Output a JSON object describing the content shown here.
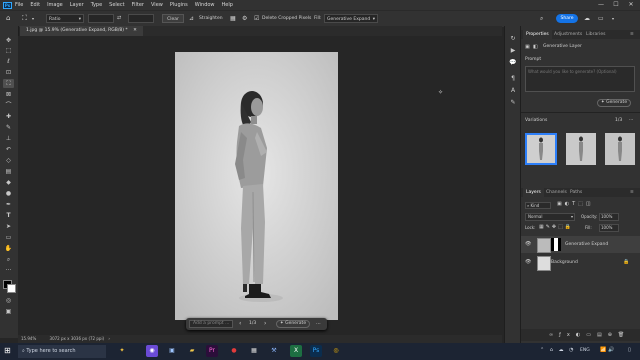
{
  "menu": {
    "logo": "Ps",
    "items": [
      "File",
      "Edit",
      "Image",
      "Layer",
      "Type",
      "Select",
      "Filter",
      "View",
      "Plugins",
      "Window",
      "Help"
    ]
  },
  "window_controls": {
    "minimize": "—",
    "maximize": "☐",
    "close": "✕"
  },
  "options": {
    "ratio_value": "Ratio",
    "clear_label": "Clear",
    "straighten_label": "Straighten",
    "delete_cropped_label": "Delete Cropped Pixels",
    "fill_label": "Fill:",
    "fill_value": "Generative Expand",
    "share_label": "Share"
  },
  "document": {
    "tab_title": "1.jpg @ 15.9% (Generative Expand, RGB/8) *",
    "close_glyph": "✕"
  },
  "contextual_bar": {
    "prompt_placeholder": "Add a prompt ...",
    "variation_counter": "1/3",
    "generate_label": "Generate",
    "more": "···"
  },
  "status": {
    "zoom": "15.94%",
    "doc_info": "3072 px x 3036 px (72 ppi)"
  },
  "properties": {
    "tabs": [
      "Properties",
      "Adjustments",
      "Libraries"
    ],
    "layer_type": "Generative Layer",
    "prompt_label": "Prompt",
    "prompt_placeholder": "What would you like to generate? (Optional)",
    "generate_label": "Generate",
    "variations_label": "Variations",
    "variations_count": "1/3"
  },
  "layers": {
    "tabs": [
      "Layers",
      "Channels",
      "Paths"
    ],
    "filter_value": "Kind",
    "blend_mode": "Normal",
    "opacity_label": "Opacity:",
    "opacity_value": "100%",
    "lock_label": "Lock:",
    "fill_label": "Fill:",
    "fill_value": "100%",
    "items": [
      {
        "name": "Generative Expand",
        "selected": true
      },
      {
        "name": "Background",
        "selected": false
      }
    ]
  },
  "taskbar": {
    "search_placeholder": "Type here to search",
    "language": "ENG"
  },
  "colors": {
    "accent": "#1473e6",
    "selection": "#3f3f3f",
    "variation_border": "#2d7ff9"
  }
}
